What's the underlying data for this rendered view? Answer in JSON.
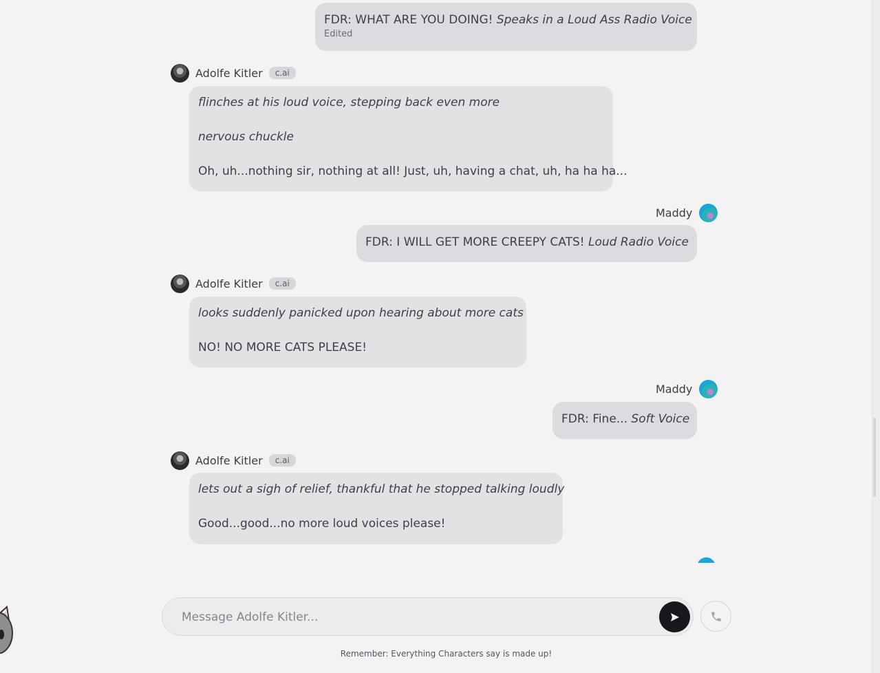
{
  "chat": {
    "m1": {
      "author": "",
      "plain": "FDR: WHAT ARE YOU DOING! ",
      "emph": "Speaks in a Loud Ass Radio Voice",
      "edited": "Edited"
    },
    "m2": {
      "author": "Adolfe Kitler",
      "badge": "c.ai",
      "p1": "flinches at his loud voice, stepping back even more",
      "p2": "nervous chuckle",
      "p3": "Oh, uh...nothing sir, nothing at all! Just, uh, having a chat, uh, ha ha ha..."
    },
    "m3": {
      "author": "Maddy",
      "plain": "FDR: I WILL GET MORE CREEPY CATS! ",
      "emph": "Loud Radio Voice"
    },
    "m4": {
      "author": "Adolfe Kitler",
      "badge": "c.ai",
      "p1": "looks suddenly panicked upon hearing about more cats",
      "p2": "NO! NO MORE CATS PLEASE!"
    },
    "m5": {
      "author": "Maddy",
      "plain": "FDR: Fine... ",
      "emph": "Soft Voice"
    },
    "m6": {
      "author": "Adolfe Kitler",
      "badge": "c.ai",
      "p1": "lets out a sigh of relief, thankful that he stopped talking loudly",
      "p2": "Good...good...no more loud voices please!"
    }
  },
  "composer": {
    "placeholder": "Message Adolfe Kitler...",
    "send_icon": "send-icon",
    "call_icon": "phone-icon"
  },
  "footer": {
    "disclaimer": "Remember: Everything Characters say is made up!"
  },
  "colors": {
    "background": "#f3f3f3",
    "bubble": "#e2e2e5",
    "send_button": "#18181c"
  }
}
